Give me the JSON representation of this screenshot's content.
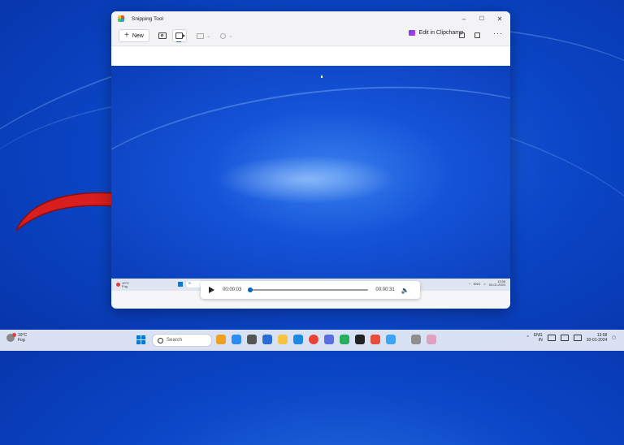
{
  "window": {
    "title": "Snipping Tool",
    "controls": {
      "minimize": "–",
      "maximize": "☐",
      "close": "✕"
    }
  },
  "toolbar": {
    "new_label": "New",
    "edit_label": "Edit in Clipchamp",
    "more_label": "···"
  },
  "preview_taskbar": {
    "weather_temp": "19°C",
    "weather_desc": "Fog",
    "search_placeholder": "S",
    "tray_lang": "ENG",
    "tray_region": "IN",
    "tray_time": "13:58",
    "tray_date": "30-01-2024"
  },
  "player": {
    "current_time": "00:00:03",
    "end_time": "00:00:31",
    "progress": 0.02
  },
  "taskbar": {
    "weather_temp": "19°C",
    "weather_desc": "Fog",
    "search_placeholder": "Search",
    "tray_lang": "ENG",
    "tray_region": "IN",
    "clock_time": "13:58",
    "clock_date": "30-01-2024"
  },
  "colors": {
    "accent": "#0067c0",
    "arrow": "#d81e1e",
    "desktop": "#0b47c8"
  }
}
